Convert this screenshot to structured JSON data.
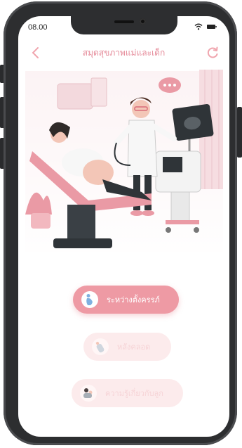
{
  "status_bar": {
    "time": "08.00"
  },
  "header": {
    "title": "สมุดสุขภาพแม่และเด็ก"
  },
  "menu": [
    {
      "label": "ระหว่างตั้งครรภ์",
      "icon": "pregnant-belly-icon",
      "active": true
    },
    {
      "label": "หลังคลอด",
      "icon": "baby-bottle-icon",
      "active": false
    },
    {
      "label": "ความรู้เกี่ยวกับลูก",
      "icon": "mother-baby-icon",
      "active": false
    }
  ],
  "colors": {
    "accent": "#ee9aa4",
    "title": "#e58a99",
    "light": "#fcebec"
  }
}
